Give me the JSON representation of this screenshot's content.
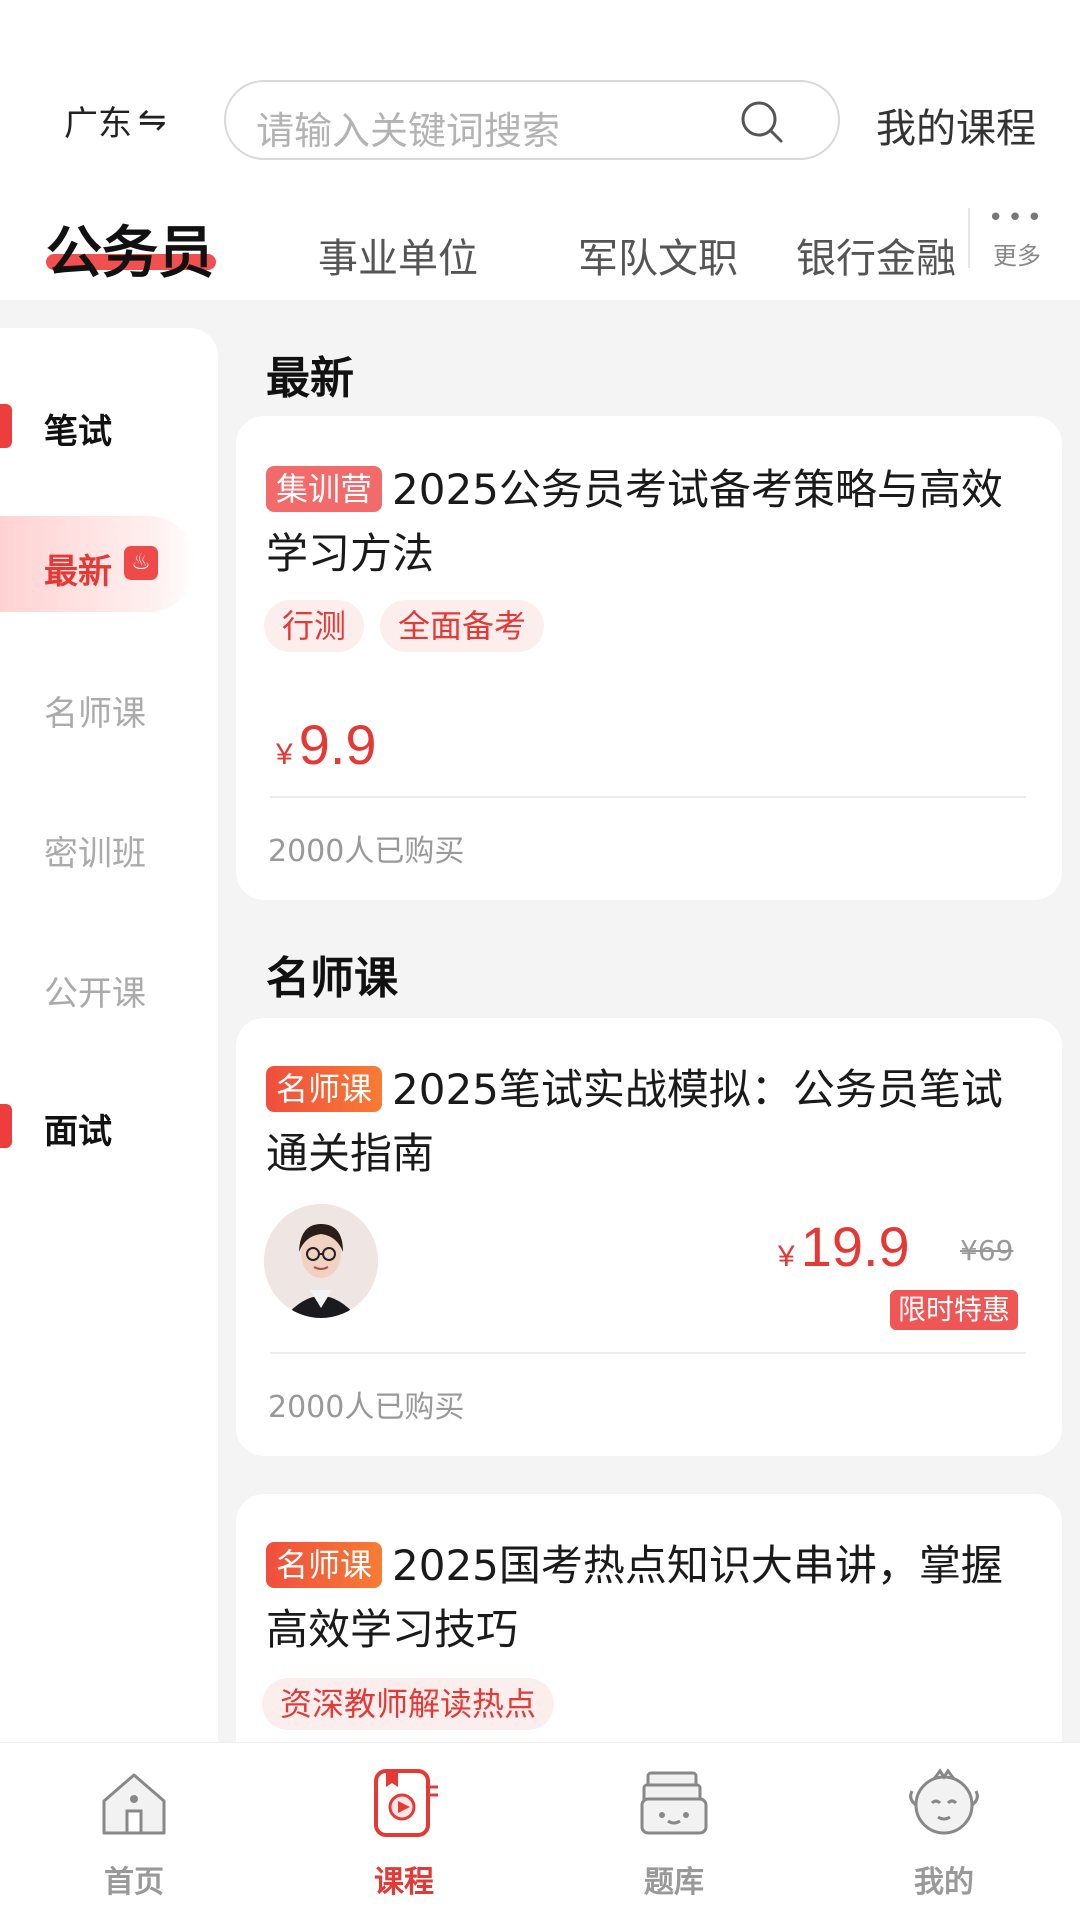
{
  "header": {
    "region": "广东",
    "region_swap_glyph": "⇋",
    "search_placeholder": "请输入关键词搜索",
    "my_courses": "我的课程"
  },
  "categories": {
    "tabs": [
      "公务员",
      "事业单位",
      "军队文职",
      "银行金融"
    ],
    "active_index": 0,
    "more_label": "更多"
  },
  "sidebar": {
    "items": [
      {
        "label": "笔试",
        "kind": "group"
      },
      {
        "label": "最新",
        "kind": "item",
        "selected": true,
        "icon": "fire-icon"
      },
      {
        "label": "名师课",
        "kind": "item"
      },
      {
        "label": "密训班",
        "kind": "item"
      },
      {
        "label": "公开课",
        "kind": "item"
      },
      {
        "label": "面试",
        "kind": "group"
      }
    ]
  },
  "sections": {
    "latest_title": "最新",
    "teacher_title": "名师课"
  },
  "cards": [
    {
      "badge": "集训营",
      "title": "2025公务员考试备考策略与高效学习方法",
      "tags": [
        "行测",
        "全面备考"
      ],
      "currency": "¥",
      "price": "9.9",
      "buyers": "2000人已购买"
    },
    {
      "badge": "名师课",
      "title": "2025笔试实战模拟：公务员笔试通关指南",
      "currency": "¥",
      "price": "19.9",
      "original_price": "¥69",
      "promo": "限时特惠",
      "buyers": "2000人已购买"
    },
    {
      "badge": "名师课",
      "title": "2025国考热点知识大串讲，掌握高效学习技巧",
      "tags": [
        "资深教师解读热点"
      ]
    }
  ],
  "tabbar": {
    "items": [
      {
        "label": "首页",
        "icon": "home-icon"
      },
      {
        "label": "课程",
        "icon": "course-icon",
        "active": true
      },
      {
        "label": "题库",
        "icon": "question-bank-icon"
      },
      {
        "label": "我的",
        "icon": "profile-icon"
      }
    ]
  },
  "colors": {
    "accent": "#e53935",
    "badge_camp": "#f36a6a",
    "badge_teacher": "#f26a3a",
    "background": "#f4f4f4"
  }
}
